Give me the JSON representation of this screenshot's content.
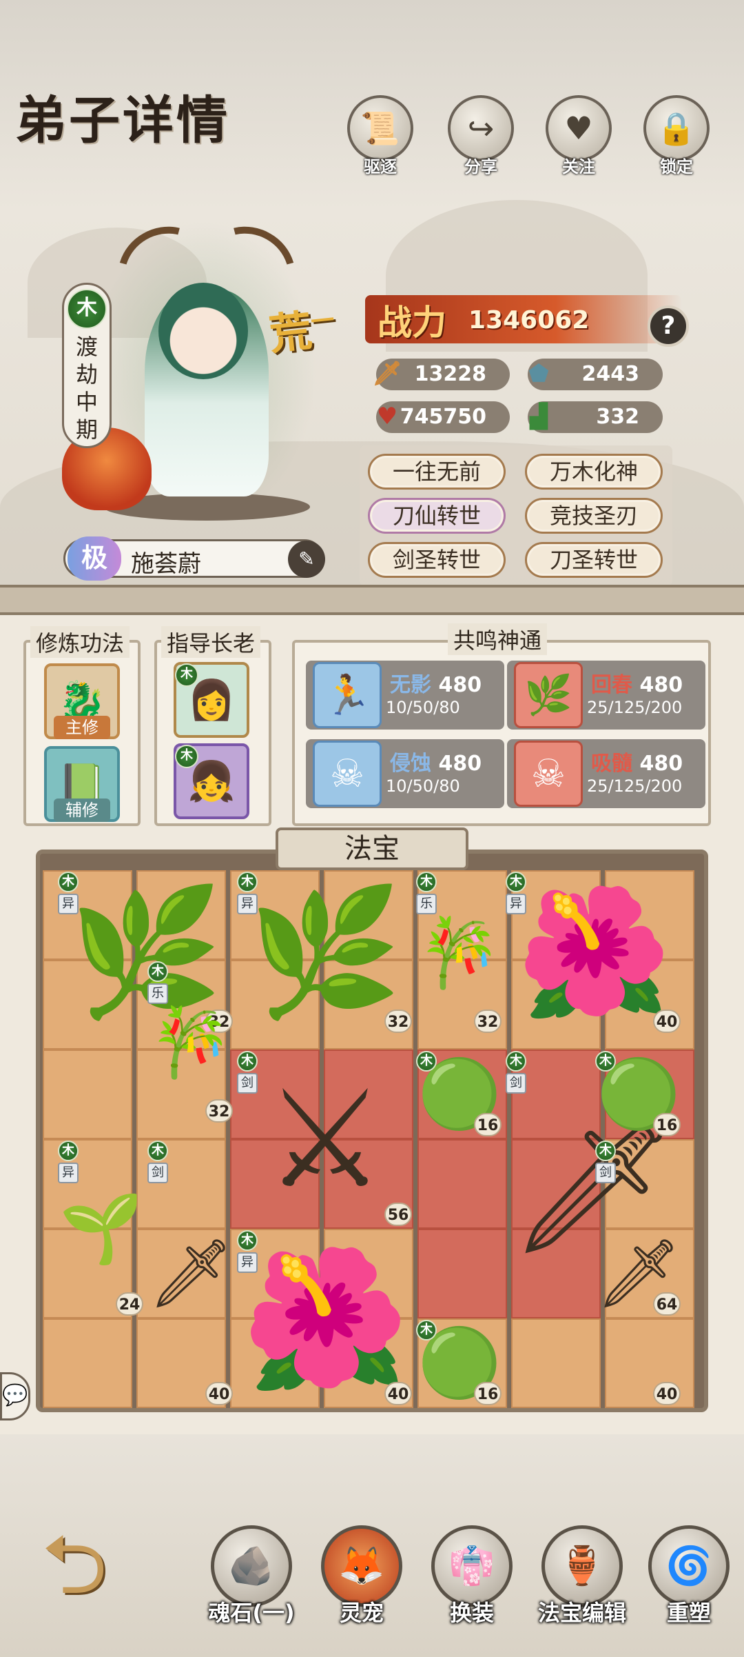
{
  "header": {
    "title": "弟子详情",
    "actions": [
      {
        "label": "驱逐",
        "icon": "scroll-icon",
        "glyph": "📜"
      },
      {
        "label": "分享",
        "icon": "share-icon",
        "glyph": "↪"
      },
      {
        "label": "关注",
        "icon": "heart-icon",
        "glyph": "♥"
      },
      {
        "label": "锁定",
        "icon": "lock-icon",
        "glyph": "🔒"
      }
    ]
  },
  "character": {
    "element": "木",
    "realm": "渡劫中期",
    "grade_mark": "荒",
    "grade_sup": "一",
    "quality": "极",
    "name": "施荟蔚"
  },
  "power": {
    "label": "战力",
    "value": "1346062",
    "help": "?"
  },
  "stats": [
    {
      "icon": "sword-icon",
      "glyph": "🗡",
      "value": "13228",
      "color": "#d28a3a"
    },
    {
      "icon": "shield-icon",
      "glyph": "⬟",
      "value": "2443",
      "color": "#5a8fa0"
    },
    {
      "icon": "heart-icon",
      "glyph": "♥",
      "value": "745750",
      "color": "#c0392b"
    },
    {
      "icon": "boot-icon",
      "glyph": "▟",
      "value": "332",
      "color": "#3b8a3a"
    }
  ],
  "skills": [
    "一往无前",
    "万木化神",
    "刀仙转世",
    "竞技圣刃",
    "剑圣转世",
    "刀圣转世"
  ],
  "cultivation": {
    "title": "修炼功法",
    "main_label": "主修",
    "aux_label": "辅修"
  },
  "mentor": {
    "title": "指导长老",
    "element": "木"
  },
  "resonance": {
    "title": "共鸣神通",
    "items": [
      {
        "name": "无影",
        "level": "480",
        "sub": "10/50/80",
        "name_color": "#8ab8e8",
        "box": "#9cc6e6"
      },
      {
        "name": "回春",
        "level": "480",
        "sub": "25/125/200",
        "name_color": "#e05a4a",
        "box": "#e88a7a"
      },
      {
        "name": "侵蚀",
        "level": "480",
        "sub": "10/50/80",
        "name_color": "#8ab8e8",
        "box": "#9cc6e6"
      },
      {
        "name": "吸髓",
        "level": "480",
        "sub": "25/125/200",
        "name_color": "#e05a4a",
        "box": "#e88a7a"
      }
    ]
  },
  "fabao": {
    "title": "法宝",
    "items": [
      {
        "element": "木",
        "type": "异",
        "level": "32",
        "art": "lotus-leaf",
        "glyph": "🌿"
      },
      {
        "element": "木",
        "type": "异",
        "level": "32",
        "art": "lotus-leaf",
        "glyph": "🌿"
      },
      {
        "element": "木",
        "type": "乐",
        "level": "32",
        "art": "bamboo-flute",
        "glyph": "🎋"
      },
      {
        "element": "木",
        "type": "异",
        "level": "40",
        "art": "purple-flower",
        "glyph": "🌺"
      },
      {
        "element": "木",
        "type": "乐",
        "level": "32",
        "art": "bamboo-flute",
        "glyph": "🎋"
      },
      {
        "element": "木",
        "type": "剑",
        "level": "56",
        "art": "twin-swords",
        "glyph": "⚔"
      },
      {
        "element": "木",
        "type": "",
        "level": "16",
        "art": "green-orb",
        "glyph": "🟢"
      },
      {
        "element": "木",
        "type": "剑",
        "level": "64",
        "art": "great-sword",
        "glyph": "🗡"
      },
      {
        "element": "木",
        "type": "",
        "level": "16",
        "art": "green-orb",
        "glyph": "🟢"
      },
      {
        "element": "木",
        "type": "异",
        "level": "24",
        "art": "tree-sapling",
        "glyph": "🌱"
      },
      {
        "element": "木",
        "type": "剑",
        "level": "40",
        "art": "vine-sword",
        "glyph": "🗡"
      },
      {
        "element": "木",
        "type": "异",
        "level": "40",
        "art": "purple-flower",
        "glyph": "🌺"
      },
      {
        "element": "木",
        "type": "",
        "level": "16",
        "art": "green-orb",
        "glyph": "🟢"
      },
      {
        "element": "木",
        "type": "剑",
        "level": "40",
        "art": "vine-sword",
        "glyph": "🗡"
      }
    ]
  },
  "bottom": [
    {
      "label": "魂石(一)",
      "glyph": "🪨"
    },
    {
      "label": "灵宠",
      "glyph": "🦊"
    },
    {
      "label": "换装",
      "glyph": "👘"
    },
    {
      "label": "法宝编辑",
      "glyph": "🏺"
    },
    {
      "label": "重塑",
      "glyph": "🌀"
    }
  ]
}
